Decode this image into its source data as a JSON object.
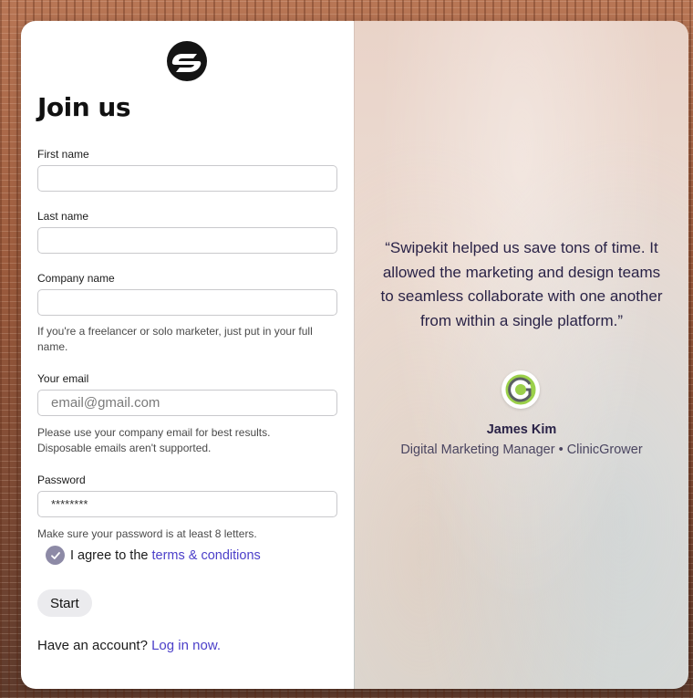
{
  "signup": {
    "title": "Join us",
    "first_name_label": "First name",
    "first_name_value": "",
    "last_name_label": "Last name",
    "last_name_value": "",
    "company_label": "Company name",
    "company_value": "",
    "company_hint": "If you're a freelancer or solo marketer, just put in your full name.",
    "email_label": "Your email",
    "email_placeholder": "email@gmail.com",
    "email_hint_1": "Please use your company email for best results.",
    "email_hint_2": "Disposable emails aren't supported.",
    "password_label": "Password",
    "password_value": "********",
    "password_hint": "Make sure your password is at least 8 letters.",
    "agree_prefix": "I agree to the ",
    "agree_link": "terms & conditions",
    "agree_checked": true,
    "start_label": "Start",
    "account_prefix": "Have an account? ",
    "account_link": "Log in now."
  },
  "testimonial": {
    "quote": "“Swipekit helped us save tons of time. It allowed the marketing and design teams to seamless collaborate with one another from within a single platform.”",
    "name": "James Kim",
    "role": "Digital Marketing Manager • ClinicGrower",
    "avatar_icon": "clinicgrower-logo-icon"
  },
  "colors": {
    "accent_link": "#4b3fc9",
    "checkbox": "#8d8aa6",
    "quote_text": "#2a2347"
  }
}
